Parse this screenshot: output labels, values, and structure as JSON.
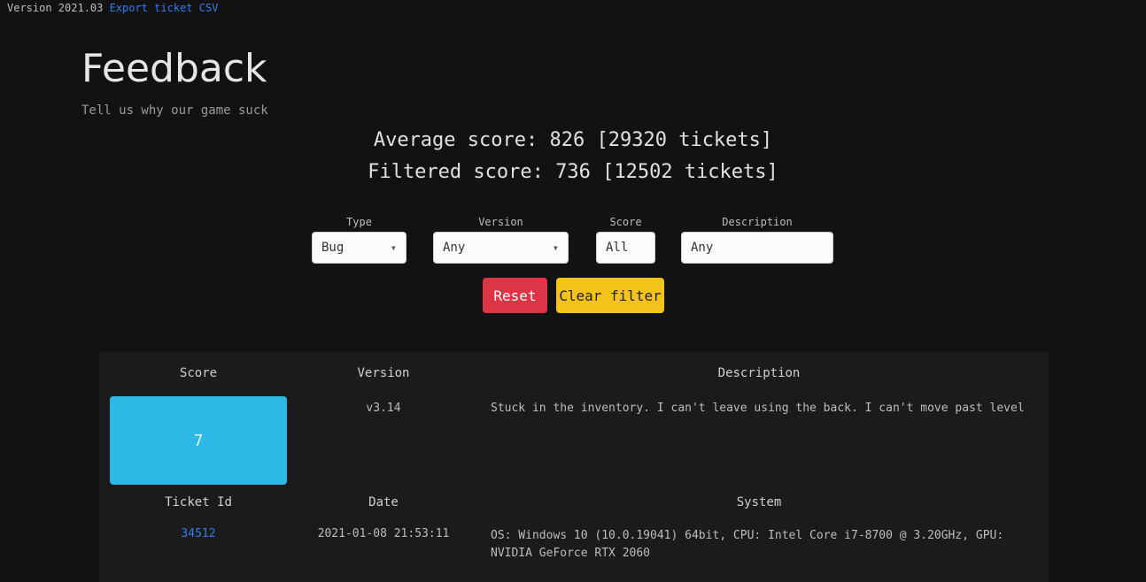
{
  "topbar": {
    "prefix": "Version 2021.03",
    "link_text": "Export ticket CSV"
  },
  "page": {
    "title": "Feedback",
    "subtitle": "Tell us why our game suck"
  },
  "stats": {
    "average": "Average score: 826 [29320 tickets]",
    "filtered": "Filtered score: 736 [12502 tickets]"
  },
  "filters": {
    "type": {
      "label": "Type",
      "value": "Bug"
    },
    "version": {
      "label": "Version",
      "value": "Any"
    },
    "score": {
      "label": "Score",
      "value": "All"
    },
    "description": {
      "label": "Description",
      "value": "Any"
    }
  },
  "buttons": {
    "reset": "Reset",
    "clear": "Clear filter"
  },
  "table": {
    "headers": {
      "score": "Score",
      "version": "Version",
      "description": "Description",
      "ticket_id": "Ticket Id",
      "date": "Date",
      "system": "System"
    },
    "row": {
      "thumb_label": "7",
      "version": "v3.14",
      "description": "Stuck in the inventory. I can't leave using the back. I can't move past level ...",
      "ticket_id": "34512",
      "date": "2021-01-08 21:53:11",
      "system": "OS: Windows 10 (10.0.19041) 64bit, CPU: Intel Core i7-8700 @ 3.20GHz, GPU: NVIDIA GeForce RTX 2060"
    }
  }
}
